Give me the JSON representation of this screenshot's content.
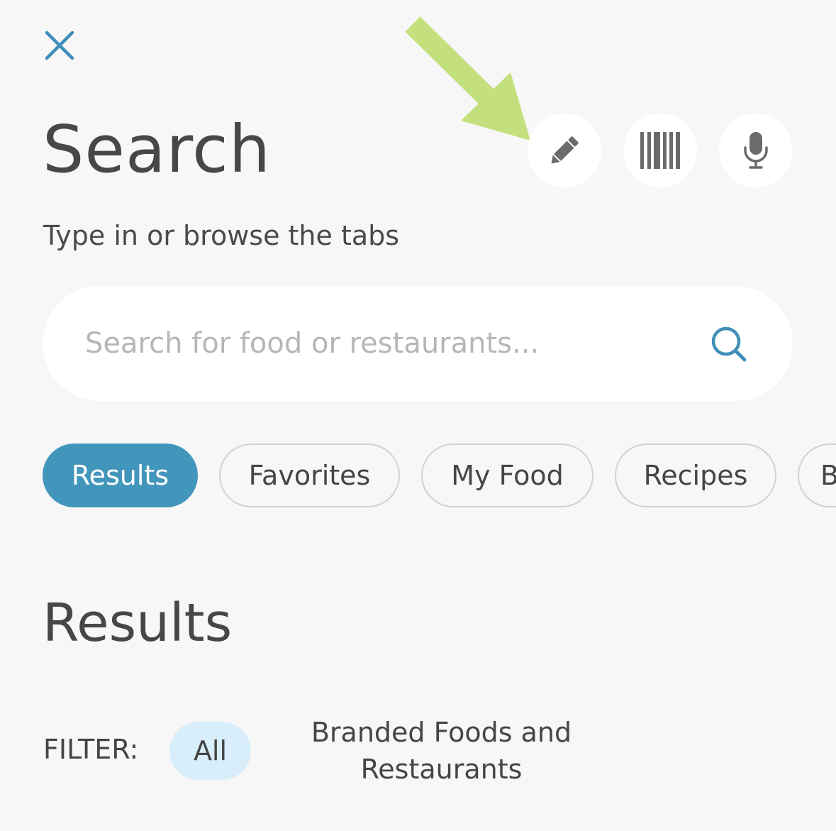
{
  "header": {
    "title": "Search",
    "subtitle": "Type in or browse the tabs",
    "close_icon": "close-icon",
    "actions": [
      {
        "name": "pencil-icon"
      },
      {
        "name": "barcode-icon"
      },
      {
        "name": "microphone-icon"
      }
    ]
  },
  "search": {
    "placeholder": "Search for food or restaurants...",
    "value": "",
    "icon": "search-icon"
  },
  "tabs": [
    {
      "label": "Results",
      "active": true
    },
    {
      "label": "Favorites",
      "active": false
    },
    {
      "label": "My Food",
      "active": false
    },
    {
      "label": "Recipes",
      "active": false
    },
    {
      "label": "B",
      "active": false
    }
  ],
  "results": {
    "title": "Results",
    "filter_label": "FILTER:",
    "filters": [
      {
        "label": "All",
        "active": true
      },
      {
        "label": "Branded Foods and Restaurants",
        "active": false
      }
    ]
  },
  "colors": {
    "accent": "#4396bb",
    "annotation_arrow": "#c4e07e",
    "filter_active_bg": "#d8eefa",
    "background": "#f7f7f7"
  }
}
